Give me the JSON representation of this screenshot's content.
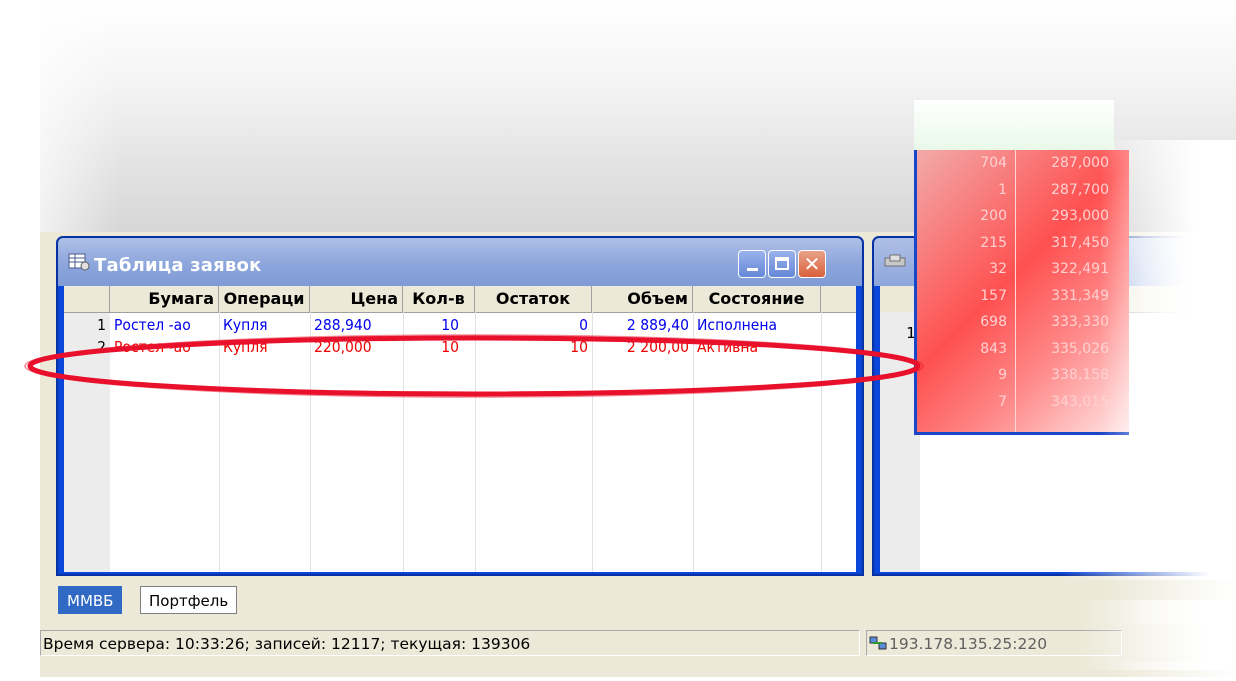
{
  "window": {
    "title": "Таблица заявок"
  },
  "orders_table": {
    "columns": [
      "Бумага",
      "Операци",
      "Цена",
      "Кол-в",
      "Остаток",
      "Объем",
      "Состояние"
    ],
    "rows": [
      {
        "num": "1",
        "security": "Ростел -ао",
        "operation": "Купля",
        "price": "288,940",
        "qty": "10",
        "remainder": "0",
        "volume": "2 889,40",
        "status": "Исполнена",
        "color": "#0000ee"
      },
      {
        "num": "2",
        "security": "Ростел -ао",
        "operation": "Купля",
        "price": "220,000",
        "qty": "10",
        "remainder": "10",
        "volume": "2 200,00",
        "status": "Активна",
        "color": "#ee0000"
      }
    ]
  },
  "second_window": {
    "row_number": "1"
  },
  "quotes": {
    "rows": [
      {
        "volume": "704",
        "price": "287,000"
      },
      {
        "volume": "1",
        "price": "287,700"
      },
      {
        "volume": "200",
        "price": "293,000"
      },
      {
        "volume": "215",
        "price": "317,450"
      },
      {
        "volume": "32",
        "price": "322,491"
      },
      {
        "volume": "157",
        "price": "331,349"
      },
      {
        "volume": "698",
        "price": "333,330"
      },
      {
        "volume": "843",
        "price": "335,026"
      },
      {
        "volume": "9",
        "price": "338,158"
      },
      {
        "volume": "7",
        "price": "343,015"
      }
    ]
  },
  "tabs": [
    "ММВБ",
    "Портфель"
  ],
  "status_bar": {
    "server_info": "Время сервера: 10:33:26; записей: 12117; текущая: 139306",
    "connection": "193.178.135.25:220"
  },
  "colors": {
    "annotation": "#e8102a",
    "active_tab": "#316ac5"
  }
}
